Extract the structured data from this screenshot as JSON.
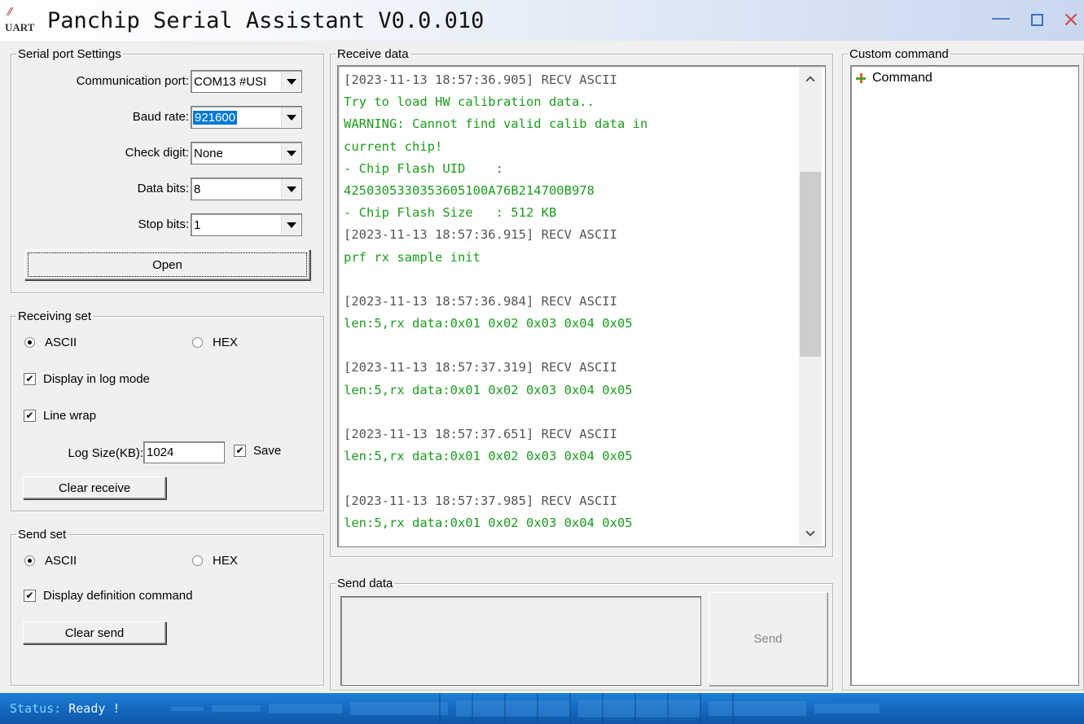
{
  "window": {
    "title": "Panchip Serial Assistant V0.0.010",
    "logo_text": "UART",
    "controls": {
      "minimize": "—",
      "close": "×"
    }
  },
  "serial_settings": {
    "legend": "Serial port Settings",
    "port_label": "Communication port:",
    "port_value": "COM13 #USI",
    "baud_label": "Baud rate:",
    "baud_value": "921600",
    "check_label": "Check digit:",
    "check_value": "None",
    "data_bits_label": "Data bits:",
    "data_bits_value": "8",
    "stop_bits_label": "Stop bits:",
    "stop_bits_value": "1",
    "open_button": "Open"
  },
  "receiving_set": {
    "legend": "Receiving set",
    "ascii_label": "ASCII",
    "hex_label": "HEX",
    "selected": "ASCII",
    "log_mode_label": "Display in log mode",
    "log_mode_checked": true,
    "line_wrap_label": "Line wrap",
    "line_wrap_checked": true,
    "log_size_label": "Log Size(KB):",
    "log_size_value": "1024",
    "save_label": "Save",
    "save_checked": true,
    "clear_button": "Clear receive"
  },
  "send_set": {
    "legend": "Send set",
    "ascii_label": "ASCII",
    "hex_label": "HEX",
    "selected": "ASCII",
    "definition_label": "Display definition command",
    "definition_checked": true,
    "clear_button": "Clear send"
  },
  "receive_data": {
    "legend": "Receive data",
    "header_color": "#555555",
    "message_color": "#1c9c1c",
    "lines": [
      {
        "type": "hdr",
        "text": "[2023-11-13 18:57:36.905] RECV ASCII"
      },
      {
        "type": "msg",
        "text": "Try to load HW calibration data.."
      },
      {
        "type": "msg",
        "text": "WARNING: Cannot find valid calib data in"
      },
      {
        "type": "msg",
        "text": "current chip!"
      },
      {
        "type": "msg",
        "text": "- Chip Flash UID    :"
      },
      {
        "type": "msg",
        "text": "4250305330353605100A76B214700B978"
      },
      {
        "type": "msg",
        "text": "- Chip Flash Size   : 512 KB"
      },
      {
        "type": "hdr",
        "text": "[2023-11-13 18:57:36.915] RECV ASCII"
      },
      {
        "type": "msg",
        "text": "prf rx sample init"
      },
      {
        "type": "msg",
        "text": ""
      },
      {
        "type": "hdr",
        "text": "[2023-11-13 18:57:36.984] RECV ASCII"
      },
      {
        "type": "msg",
        "text": "len:5,rx data:0x01 0x02 0x03 0x04 0x05"
      },
      {
        "type": "msg",
        "text": ""
      },
      {
        "type": "hdr",
        "text": "[2023-11-13 18:57:37.319] RECV ASCII"
      },
      {
        "type": "msg",
        "text": "len:5,rx data:0x01 0x02 0x03 0x04 0x05"
      },
      {
        "type": "msg",
        "text": ""
      },
      {
        "type": "hdr",
        "text": "[2023-11-13 18:57:37.651] RECV ASCII"
      },
      {
        "type": "msg",
        "text": "len:5,rx data:0x01 0x02 0x03 0x04 0x05"
      },
      {
        "type": "msg",
        "text": ""
      },
      {
        "type": "hdr",
        "text": "[2023-11-13 18:57:37.985] RECV ASCII"
      },
      {
        "type": "msg",
        "text": "len:5,rx data:0x01 0x02 0x03 0x04 0x05"
      }
    ]
  },
  "send_data": {
    "legend": "Send data",
    "value": "",
    "send_button": "Send"
  },
  "custom_command": {
    "legend": "Custom command",
    "root_item": "Command"
  },
  "status": {
    "key": "Status:",
    "value": "Ready !"
  },
  "colors": {
    "accent": "#0078d7",
    "status_bar": "#156ac0"
  }
}
